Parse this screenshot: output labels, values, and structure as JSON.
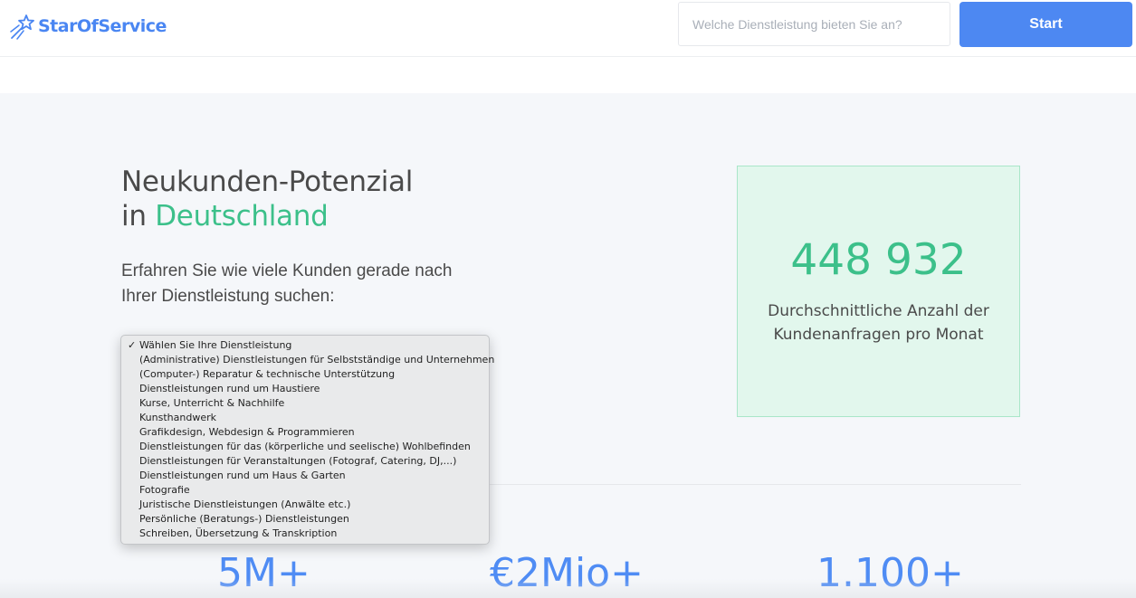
{
  "header": {
    "logo_text": "StarOfService",
    "search_placeholder": "Welche Dienstleistung bieten Sie an?",
    "start_label": "Start"
  },
  "hero": {
    "title_line1": "Neukunden-Potenzial",
    "title_prefix": "in",
    "title_highlight": "Deutschland",
    "subtitle": "Erfahren Sie wie viele Kunden gerade nach Ihrer Dienstleistung suchen:"
  },
  "dropdown": {
    "options": [
      "Wählen Sie Ihre Dienstleistung",
      "(Administrative) Dienstleistungen für Selbstständige und Unternehmen",
      "(Computer-) Reparatur & technische Unterstützung",
      "Dienstleistungen rund um Haustiere",
      "Kurse, Unterricht & Nachhilfe",
      "Kunsthandwerk",
      "Grafikdesign, Webdesign & Programmieren",
      "Dienstleistungen für das (körperliche und seelische) Wohlbefinden",
      "Dienstleistungen für Veranstaltungen (Fotograf, Catering, DJ,...)",
      "Dienstleistungen rund um Haus & Garten",
      "Fotografie",
      "Juristische Dienstleistungen (Anwälte etc.)",
      "Persönliche (Beratungs-) Dienstleistungen",
      "Schreiben, Übersetzung & Transkription"
    ],
    "selected_index": 0
  },
  "stat_box": {
    "number": "448 932",
    "label_line1": "Durchschnittliche Anzahl der",
    "label_line2": "Kundenanfragen pro Monat"
  },
  "stats": [
    "5M+",
    "€2Mio+",
    "1.100+"
  ],
  "colors": {
    "brand_blue": "#4d88f2",
    "accent_green": "#3cc08a",
    "stat_box_bg": "#e2f7ed",
    "stat_blue": "#4f8cf4"
  }
}
